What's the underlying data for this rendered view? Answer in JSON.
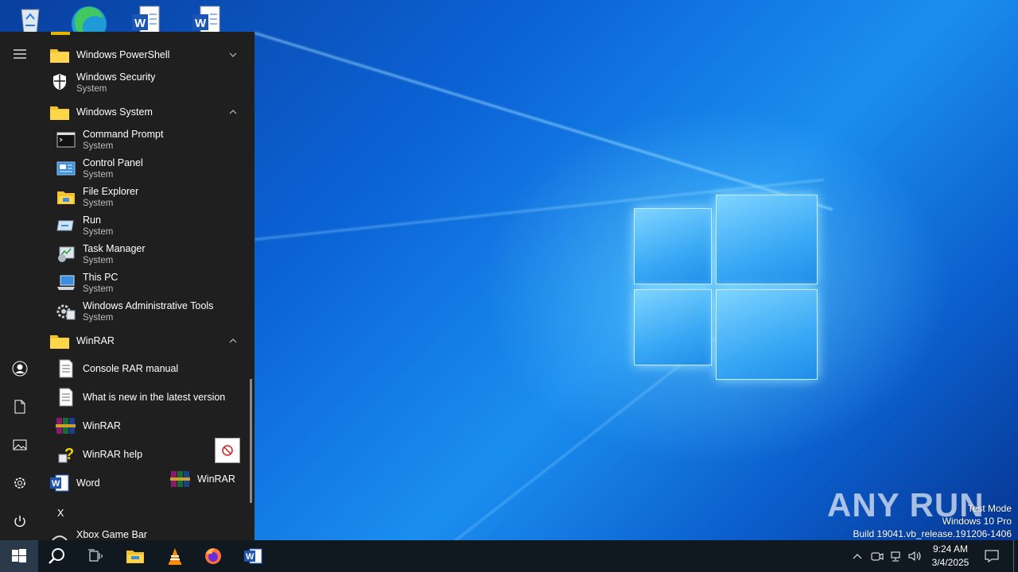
{
  "desktop": {
    "icons": [
      "recycle-bin-icon",
      "edge-icon",
      "word-doc-icon",
      "word-doc-icon"
    ],
    "watermark": {
      "line1": "Test Mode",
      "line2": "Windows 10 Pro",
      "line3": "Build 19041.vb_release.191206-1406"
    },
    "brand": "ANY RUN"
  },
  "start_menu": {
    "rail": [
      "hamburger-icon",
      "user-icon",
      "document-icon",
      "pictures-icon",
      "settings-icon",
      "power-icon"
    ],
    "items": [
      {
        "label": "Windows PowerShell",
        "type": "folder",
        "expanded": false
      },
      {
        "label": "Windows Security",
        "sub": "System"
      },
      {
        "label": "Windows System",
        "type": "folder",
        "expanded": true
      },
      {
        "label": "Command Prompt",
        "sub": "System"
      },
      {
        "label": "Control Panel",
        "sub": "System"
      },
      {
        "label": "File Explorer",
        "sub": "System"
      },
      {
        "label": "Run",
        "sub": "System"
      },
      {
        "label": "Task Manager",
        "sub": "System"
      },
      {
        "label": "This PC",
        "sub": "System"
      },
      {
        "label": "Windows Administrative Tools",
        "sub": "System"
      },
      {
        "label": "WinRAR",
        "type": "folder",
        "expanded": true
      },
      {
        "label": "Console RAR manual"
      },
      {
        "label": "What is new in the latest version"
      },
      {
        "label": "WinRAR"
      },
      {
        "label": "WinRAR help"
      },
      {
        "label": "Word"
      },
      {
        "label": "X",
        "type": "letter"
      },
      {
        "label": "Xbox Game Bar"
      }
    ],
    "drag_ghost": "WinRAR"
  },
  "taskbar": {
    "apps": [
      "windows-start-icon",
      "search-icon",
      "task-view-icon",
      "file-explorer-icon",
      "vlc-icon",
      "firefox-icon",
      "word-icon"
    ],
    "time": "9:24 AM",
    "date": "3/4/2025"
  }
}
